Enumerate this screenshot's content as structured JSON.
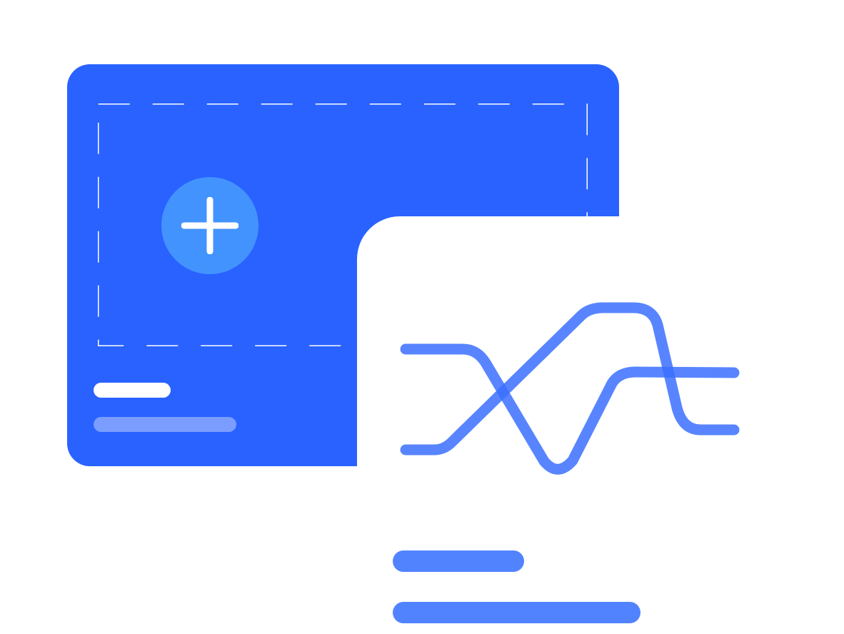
{
  "colors": {
    "card_blue": "#2962ff",
    "button_blue": "#4393ff",
    "dash_white": "#ffffff",
    "muted_line": "#7b9dff",
    "curve_blue": "#3b70ff",
    "placeholder_line": "#5283ff"
  },
  "icons": {
    "add": "plus-icon",
    "chart": "crossing-lines-chart-icon"
  }
}
